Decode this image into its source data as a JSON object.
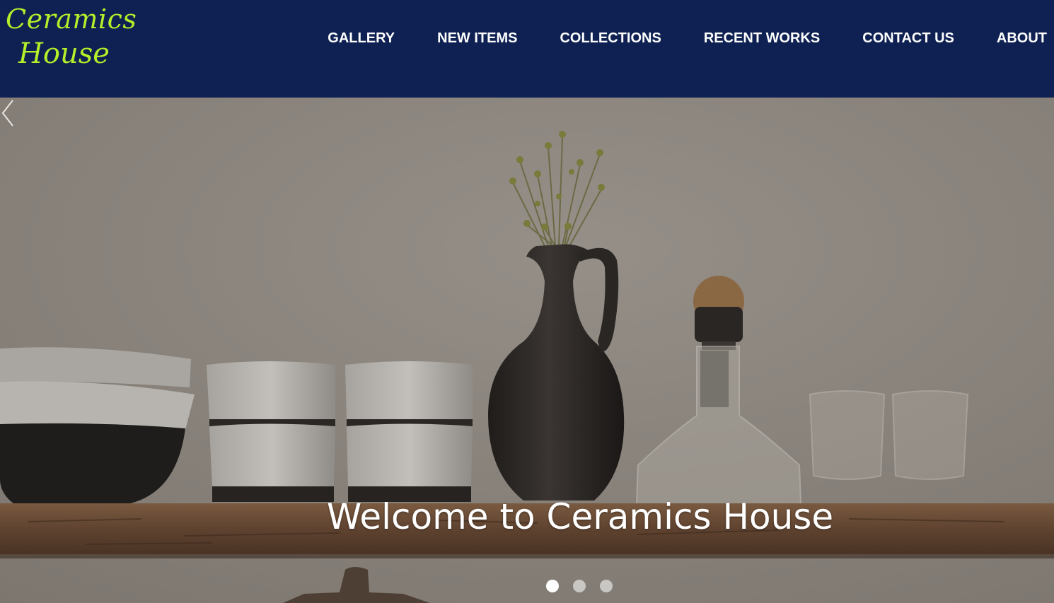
{
  "brand": {
    "line1": "Ceramics",
    "line2": "House",
    "color": "#b5ee2a"
  },
  "header": {
    "background": "#0e2152"
  },
  "nav": {
    "items": [
      {
        "label": "GALLERY"
      },
      {
        "label": "NEW ITEMS"
      },
      {
        "label": "COLLECTIONS"
      },
      {
        "label": "RECENT WORKS"
      },
      {
        "label": "CONTACT US"
      },
      {
        "label": "ABOUT"
      }
    ]
  },
  "hero": {
    "caption": "Welcome to Ceramics House",
    "prev_icon": "chevron-left-icon",
    "slides": {
      "count": 3,
      "active": 1
    }
  }
}
